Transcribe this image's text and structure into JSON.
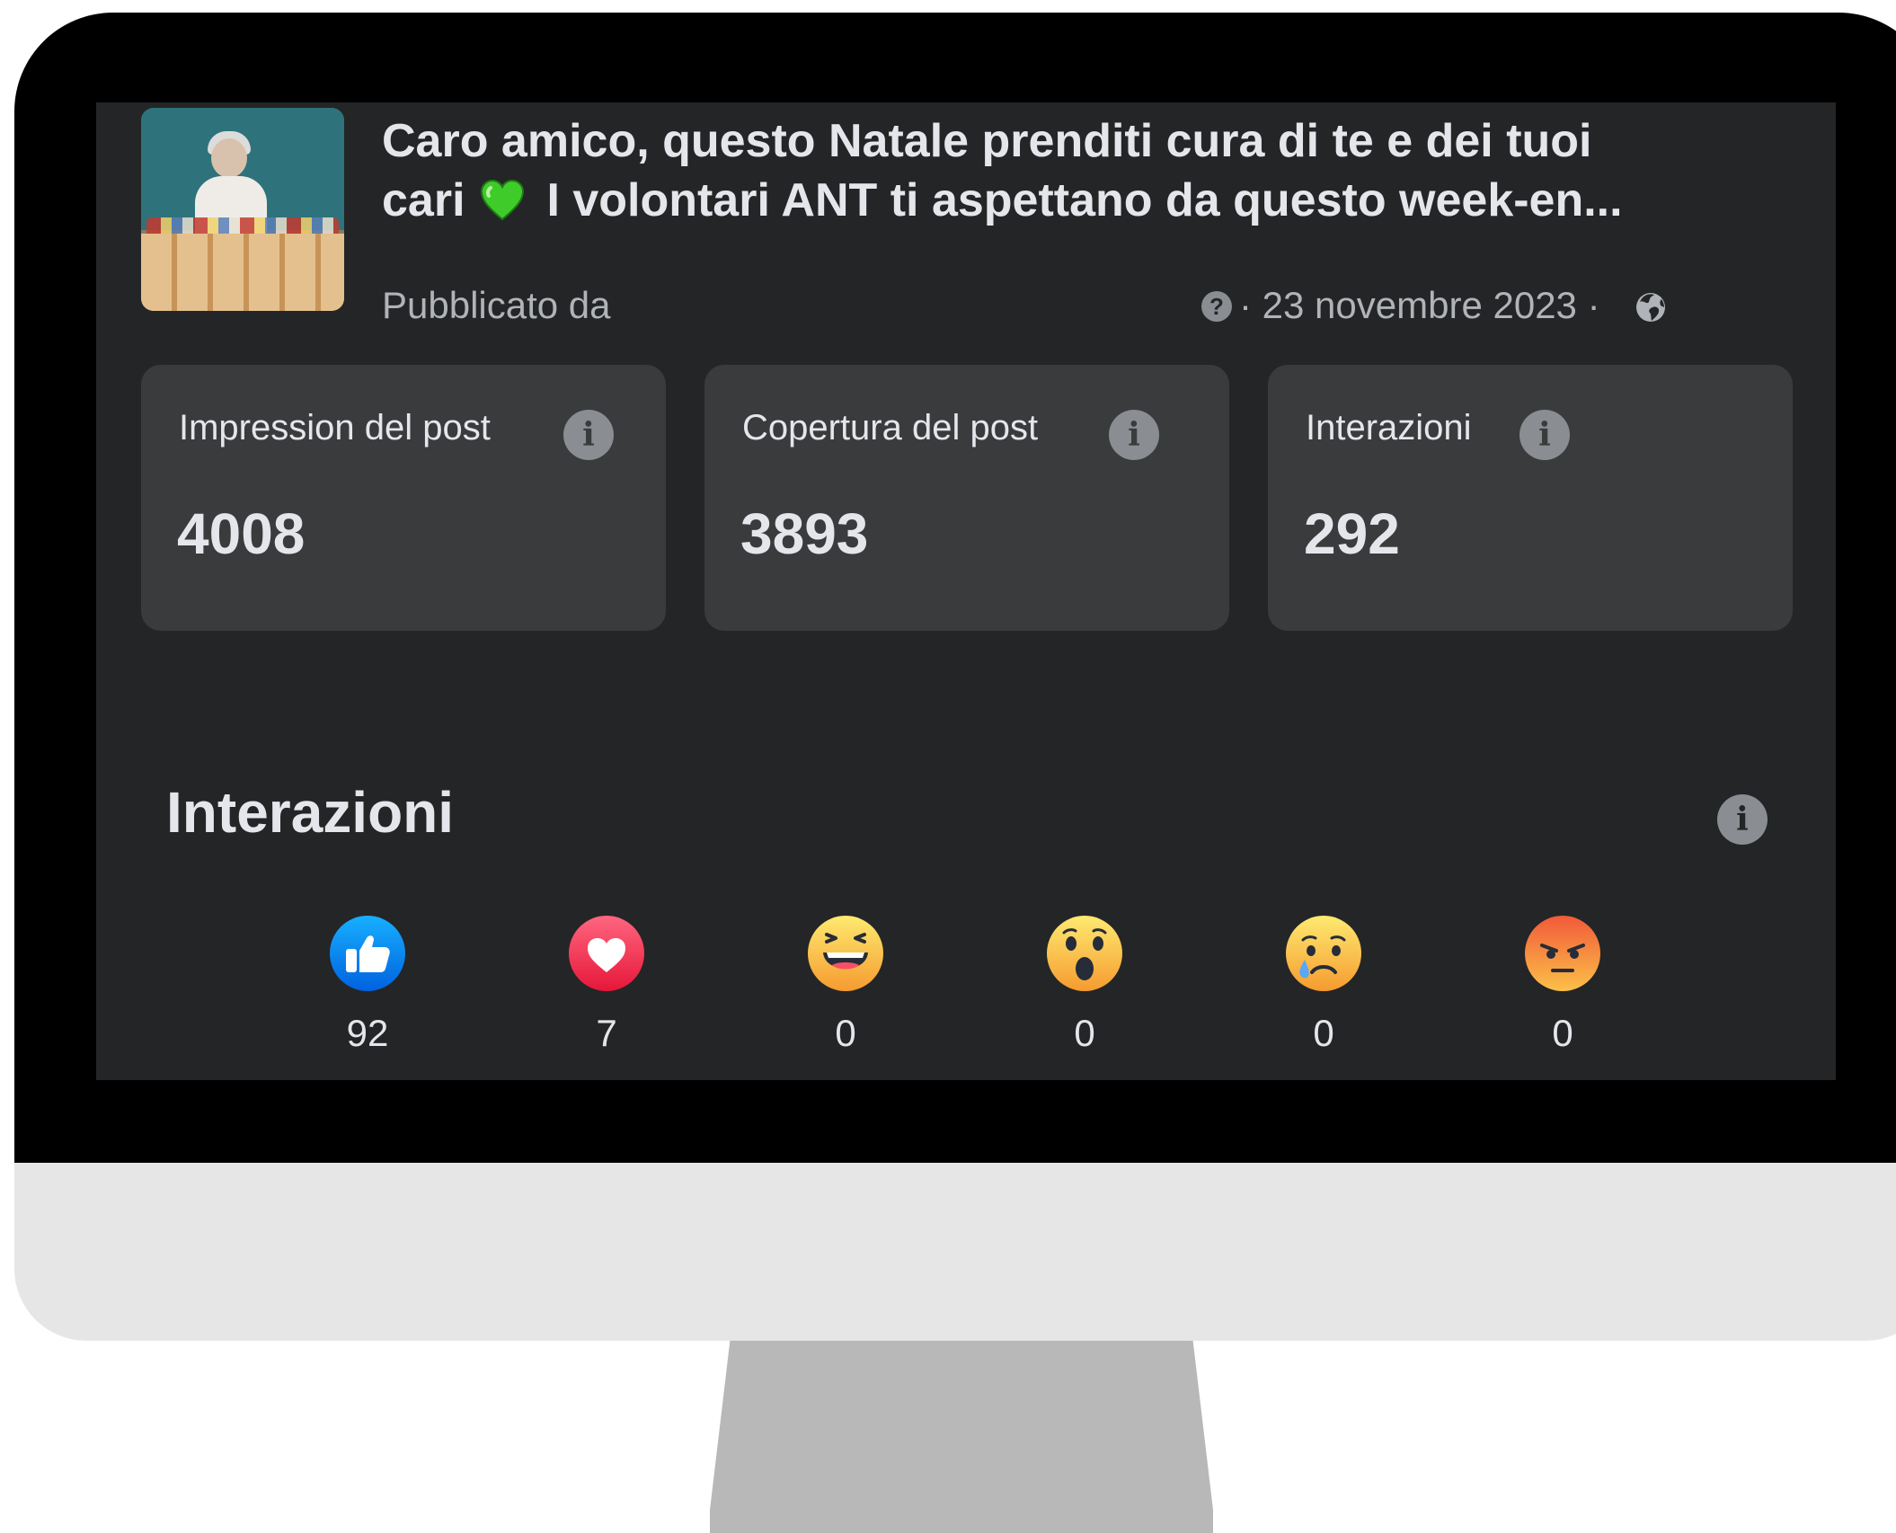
{
  "post": {
    "title_line1": "Caro amico, questo Natale prenditi cura di te e dei tuoi",
    "title_line2_before": "cari",
    "title_line2_after": "I volontari ANT ti aspettano da questo week-en...",
    "heart_icon": "green-heart-icon",
    "published_by": "Pubblicato da",
    "help_symbol": "?",
    "date": "· 23 novembre 2023 ·",
    "visibility_icon": "globe-icon"
  },
  "metrics": [
    {
      "label": "Impression del post",
      "value": "4008"
    },
    {
      "label": "Copertura del post",
      "value": "3893"
    },
    {
      "label": "Interazioni",
      "value": "292"
    }
  ],
  "interactions": {
    "title": "Interazioni",
    "info_symbol": "i",
    "reactions": [
      {
        "icon": "like-icon",
        "count": "92",
        "color": "#1877f2"
      },
      {
        "icon": "love-icon",
        "count": "7",
        "color": "#f33e58"
      },
      {
        "icon": "haha-icon",
        "count": "0",
        "color": "#f7b125"
      },
      {
        "icon": "wow-icon",
        "count": "0",
        "color": "#f7b125"
      },
      {
        "icon": "sad-icon",
        "count": "0",
        "color": "#f7b125"
      },
      {
        "icon": "angry-icon",
        "count": "0",
        "color": "#e9710f"
      }
    ]
  },
  "colors": {
    "screen_background": "#242526",
    "card_background": "#3a3b3c",
    "text_primary": "#e4e6eb",
    "text_secondary": "#b0b3b8"
  }
}
